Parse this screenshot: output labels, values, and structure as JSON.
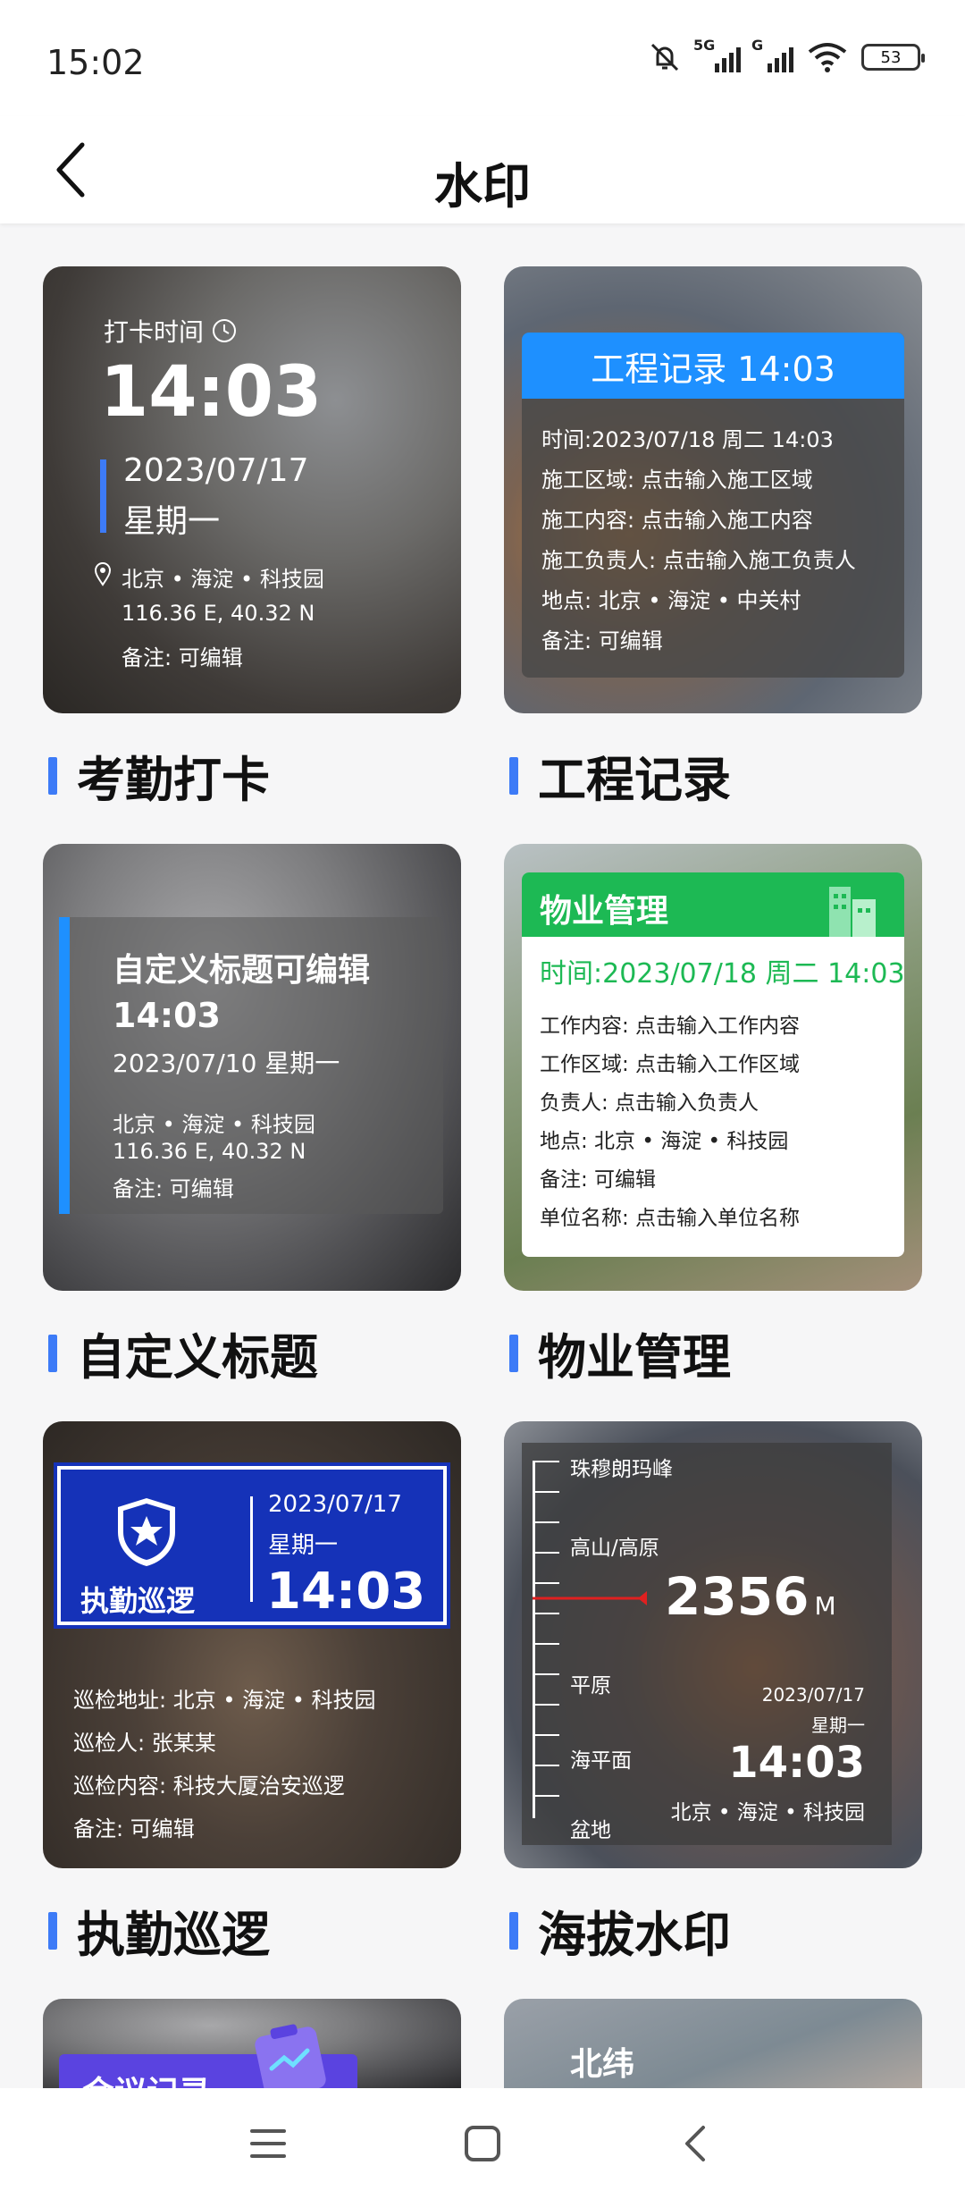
{
  "status": {
    "time": "15:02",
    "battery": "53",
    "net1": "5G",
    "net2": "G"
  },
  "header": {
    "title": "水印"
  },
  "cards": {
    "attendance": {
      "label": "考勤打卡",
      "wm_title": "打卡时间",
      "time": "14:03",
      "date": "2023/07/17",
      "weekday": "星期一",
      "location": "北京 • 海淀 • 科技园",
      "coords": "116.36 E, 40.32 N",
      "note": "备注: 可编辑"
    },
    "engineering": {
      "label": "工程记录",
      "wm_title": "工程记录 14:03",
      "rows": [
        "时间:2023/07/18 周二 14:03",
        "施工区域:  点击输入施工区域",
        "施工内容:  点击输入施工内容",
        "施工负责人:  点击输入施工负责人",
        "地点:   北京 • 海淀 • 中关村",
        "备注: 可编辑"
      ]
    },
    "custom": {
      "label": "自定义标题",
      "wm_title": "自定义标题可编辑",
      "time": "14:03",
      "date": "2023/07/10  星期一",
      "location": "北京 • 海淀 • 科技园",
      "coords": "116.36 E, 40.32 N",
      "note": "备注:   可编辑"
    },
    "property": {
      "label": "物业管理",
      "wm_title": "物业管理",
      "time_line": "时间:2023/07/18 周二 14:03",
      "rows": [
        "工作内容:  点击输入工作内容",
        "工作区域:  点击输入工作区域",
        "负责人:    点击输入负责人",
        "地点:   北京 • 海淀 • 科技园",
        "备注: 可编辑",
        "单位名称:  点击输入单位名称"
      ]
    },
    "patrol": {
      "label": "执勤巡逻",
      "badge": "执勤巡逻",
      "date": "2023/07/17",
      "weekday": "星期一",
      "time": "14:03",
      "rows": [
        "巡检地址:  北京 • 海淀 • 科技园",
        "巡检人:  张某某",
        "巡检内容:  科技大厦治安巡逻",
        "备注:  可编辑"
      ]
    },
    "altitude": {
      "label": "海拔水印",
      "levels": [
        "珠穆朗玛峰",
        "高山/高原",
        "平原",
        "海平面",
        "盆地"
      ],
      "value": "2356",
      "unit": "M",
      "date": "2023/07/17",
      "weekday": "星期一",
      "time": "14:03",
      "location": "北京 • 海淀 • 科技园"
    },
    "meeting_partial": {
      "title": "会议记录"
    },
    "latitude_partial": {
      "title": "北纬"
    }
  },
  "colors": {
    "accent": "#3d7bf7",
    "eng_blue": "#1e90ff",
    "property_green": "#1db954",
    "patrol_blue": "#1532b8"
  },
  "nav": {
    "icons": [
      "menu-icon",
      "home-square-icon",
      "back-chevron-icon"
    ]
  }
}
